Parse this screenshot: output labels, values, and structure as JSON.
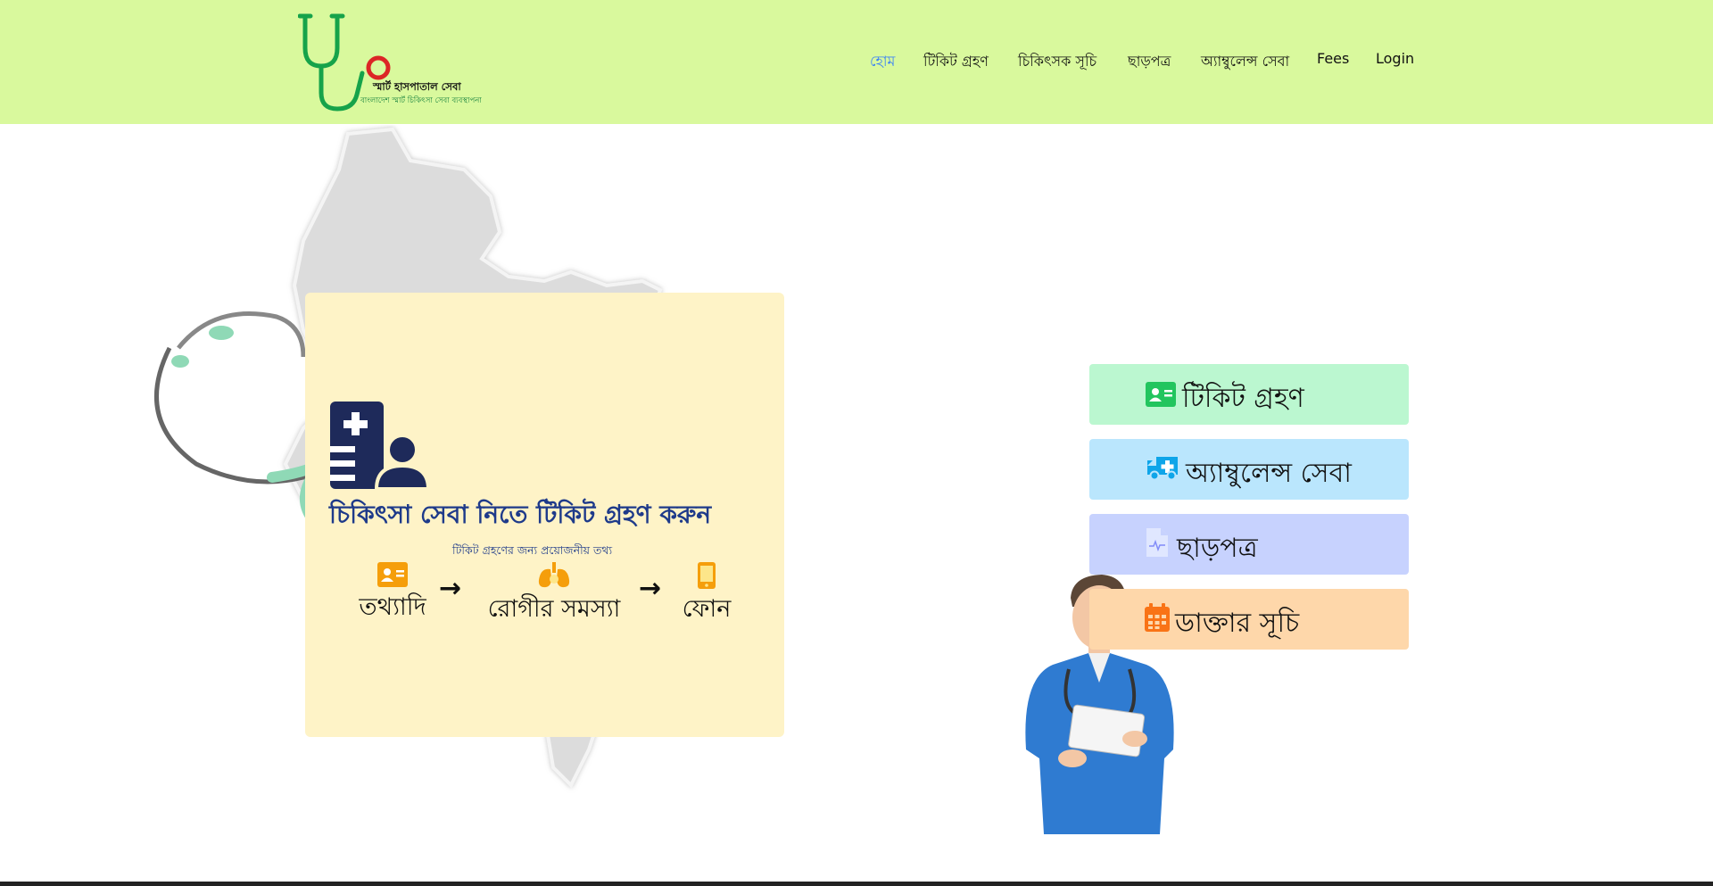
{
  "header": {
    "logo_title": "স্মার্ট হাসপাতাল সেবা",
    "logo_subtitle": "বাংলাদেশ স্মার্ট চিকিৎসা সেবা ব্যবস্থাপনা",
    "nav": [
      {
        "label": "হোম",
        "active": true
      },
      {
        "label": "টিকিট গ্রহণ",
        "active": false
      },
      {
        "label": "চিকিৎসক সূচি",
        "active": false
      },
      {
        "label": "ছাড়পত্র",
        "active": false
      },
      {
        "label": "অ্যাম্বুলেন্স সেবা",
        "active": false
      },
      {
        "label": "Fees",
        "active": false
      },
      {
        "label": "Login",
        "active": false
      }
    ]
  },
  "ticket_card": {
    "title": "চিকিৎসা সেবা নিতে টিকিট গ্রহণ করুন",
    "subtitle": "টিকিট গ্রহণের জন্য প্রয়োজনীয় তথ্য",
    "steps": [
      {
        "label": "তথ্যাদি",
        "icon": "id-card-icon"
      },
      {
        "label": "রোগীর সমস্যা",
        "icon": "lungs-icon"
      },
      {
        "label": "ফোন",
        "icon": "phone-icon"
      }
    ]
  },
  "quick_actions": [
    {
      "label": "টিকিট গ্রহণ",
      "icon": "id-card-icon",
      "color": "#bbf7d0"
    },
    {
      "label": "অ্যাম্বুলেন্স সেবা",
      "icon": "ambulance-icon",
      "color": "#bae6fd"
    },
    {
      "label": "ছাড়পত্র",
      "icon": "medical-file-icon",
      "color": "#c7d2fe"
    },
    {
      "label": "ডাক্তার সূচি",
      "icon": "calendar-icon",
      "color": "#fed7aa"
    }
  ],
  "colors": {
    "header_bg": "#d9f99d",
    "brand_green": "#16a34a",
    "brand_red": "#dc2626",
    "title_blue": "#1e3a8a",
    "accent_orange": "#f59e0b",
    "nav_active": "#3b82f6"
  }
}
